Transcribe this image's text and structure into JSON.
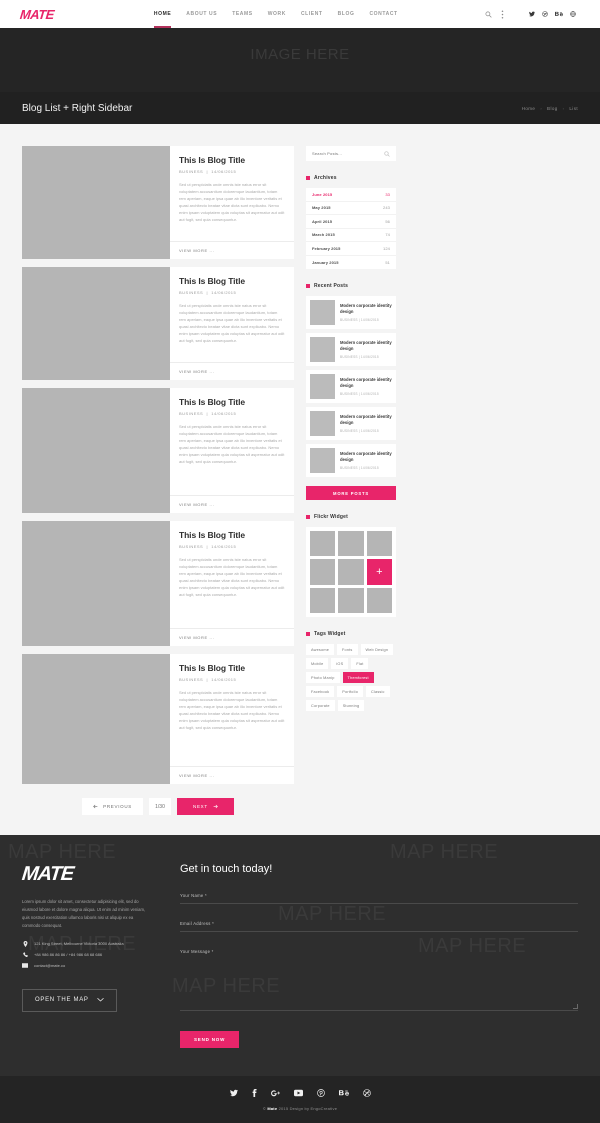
{
  "header": {
    "logo": "MATE",
    "nav": [
      {
        "label": "HOME",
        "active": true
      },
      {
        "label": "ABOUT US",
        "active": false
      },
      {
        "label": "TEAMS",
        "active": false
      },
      {
        "label": "WORK",
        "active": false
      },
      {
        "label": "CLIENT",
        "active": false
      },
      {
        "label": "BLOG",
        "active": false
      },
      {
        "label": "CONTACT",
        "active": false
      }
    ],
    "icons": [
      "search-icon",
      "more-vertical-icon"
    ],
    "social": [
      "twitter-icon",
      "dribbble-icon",
      "behance-icon",
      "globe-icon"
    ]
  },
  "hero": {
    "placeholder": "IMAGE HERE",
    "title": "Blog List + Right Sidebar",
    "breadcrumb": [
      "Home",
      "Blog",
      "List"
    ]
  },
  "posts": [
    {
      "title": "This Is Blog Title",
      "category": "BUSINESS",
      "date": "14/06/2015",
      "excerpt": "Sed ut perspiciatis unde omnis iste natus error sit voluptatem accusantium doloremque laudantium, totam rem aperiam, eaque ipsa quae ab illo inventore veritatis et quasi architecto beatae vitae dicta sunt explicabo. Nemo enim ipsam voluptatem quia voluptas sit aspernatur aut odit aut fugit, sed quia consequuntur.",
      "more_label": "VIEW MORE ..."
    },
    {
      "title": "This Is Blog Title",
      "category": "BUSINESS",
      "date": "14/06/2015",
      "excerpt": "Sed ut perspiciatis unde omnis iste natus error sit voluptatem accusantium doloremque laudantium, totam rem aperiam, eaque ipsa quae ab illo inventore veritatis et quasi architecto beatae vitae dicta sunt explicabo. Nemo enim ipsam voluptatem quia voluptas sit aspernatur aut odit aut fugit, sed quia consequuntur.",
      "more_label": "VIEW MORE ..."
    },
    {
      "title": "This Is Blog Title",
      "category": "BUSINESS",
      "date": "14/06/2015",
      "excerpt": "Sed ut perspiciatis unde omnis iste natus error sit voluptatem accusantium doloremque laudantium, totam rem aperiam, eaque ipsa quae ab illo inventore veritatis et quasi architecto beatae vitae dicta sunt explicabo. Nemo enim ipsam voluptatem quia voluptas sit aspernatur aut odit aut fugit, sed quia consequuntur.",
      "more_label": "VIEW MORE ..."
    },
    {
      "title": "This Is Blog Title",
      "category": "BUSINESS",
      "date": "14/06/2015",
      "excerpt": "Sed ut perspiciatis unde omnis iste natus error sit voluptatem accusantium doloremque laudantium, totam rem aperiam, eaque ipsa quae ab illo inventore veritatis et quasi architecto beatae vitae dicta sunt explicabo. Nemo enim ipsam voluptatem quia voluptas sit aspernatur aut odit aut fugit, sed quia consequuntur.",
      "more_label": "VIEW MORE ..."
    },
    {
      "title": "This Is Blog Title",
      "category": "BUSINESS",
      "date": "14/06/2015",
      "excerpt": "Sed ut perspiciatis unde omnis iste natus error sit voluptatem accusantium doloremque laudantium, totam rem aperiam, eaque ipsa quae ab illo inventore veritatis et quasi architecto beatae vitae dicta sunt explicabo. Nemo enim ipsam voluptatem quia voluptas sit aspernatur aut odit aut fugit, sed quia consequuntur.",
      "more_label": "VIEW MORE ..."
    }
  ],
  "pagination": {
    "previous": "PREVIOUS",
    "page": "1/30",
    "next": "NEXT"
  },
  "sidebar": {
    "search_placeholder": "Search Posts...",
    "archives": {
      "title": "Archives",
      "rows": [
        {
          "label": "June 2015",
          "count": "33",
          "active": true
        },
        {
          "label": "May 2015",
          "count": "243",
          "active": false
        },
        {
          "label": "April 2015",
          "count": "56",
          "active": false
        },
        {
          "label": "March 2015",
          "count": "74",
          "active": false
        },
        {
          "label": "February 2015",
          "count": "124",
          "active": false
        },
        {
          "label": "January 2015",
          "count": "51",
          "active": false
        }
      ]
    },
    "recent_posts": {
      "title": "Recent Posts",
      "items": [
        {
          "title": "Modern corporate identity design",
          "meta": "BUSINESS   |   14/06/2015"
        },
        {
          "title": "Modern corporate identity design",
          "meta": "BUSINESS   |   14/06/2015"
        },
        {
          "title": "Modern corporate identity design",
          "meta": "BUSINESS   |   14/06/2015"
        },
        {
          "title": "Modern corporate identity design",
          "meta": "BUSINESS   |   14/06/2015"
        },
        {
          "title": "Modern corporate identity design",
          "meta": "BUSINESS   |   14/06/2015"
        }
      ],
      "more_label": "MORE POSTS"
    },
    "flickr": {
      "title": "Flickr Widget",
      "tiles": 9,
      "active_index": 5,
      "active_glyph": "+"
    },
    "tags": {
      "title": "Tags Widget",
      "items": [
        {
          "label": "Awesome",
          "active": false
        },
        {
          "label": "Fonts",
          "active": false
        },
        {
          "label": "Web Design",
          "active": false
        },
        {
          "label": "Mobile",
          "active": false
        },
        {
          "label": "iOS",
          "active": false
        },
        {
          "label": "Flat",
          "active": false
        },
        {
          "label": "Photo Manip",
          "active": false
        },
        {
          "label": "Themforest",
          "active": true
        },
        {
          "label": "Facebook",
          "active": false
        },
        {
          "label": "Portfolio",
          "active": false
        },
        {
          "label": "Classic",
          "active": false
        },
        {
          "label": "Corporate",
          "active": false
        },
        {
          "label": "Stunning",
          "active": false
        }
      ]
    }
  },
  "footer": {
    "map_ghost": "MAP HERE",
    "logo": "MATE",
    "about": "Lorem ipsum dolor sit amet, consectetur adipisicing elit, sed do eiusmod labore et dolore magna aliqua. Ut enim ad minim veniam, quis nostrud exercitation ullamco laboris nisi ut aliquip ex ea commodo consequat.",
    "contacts": [
      {
        "icon": "location-pin-icon",
        "text": "121 King Street, Melbourne Victoria 3000 Australia"
      },
      {
        "icon": "phone-icon",
        "text": "+84 986 86 86 86 / +84 986 68 68 686"
      },
      {
        "icon": "envelope-icon",
        "text": "contact@mate.co"
      }
    ],
    "map_button": "OPEN THE MAP",
    "form": {
      "heading": "Get in touch today!",
      "name_label": "Your Name *",
      "email_label": "Email Address *",
      "message_label": "Your Message *",
      "submit": "SEND NOW"
    }
  },
  "bottom": {
    "social": [
      "twitter-icon",
      "facebook-icon",
      "google-plus-icon",
      "youtube-icon",
      "pinterest-icon",
      "behance-icon",
      "dribbble-icon"
    ],
    "copyright_prefix": "© ",
    "copyright_brand": "Mate",
    "copyright_suffix": " 2015 Design by EngoCreative"
  },
  "colors": {
    "accent": "#e8256a",
    "dark": "#2e2e2e",
    "hero": "#252525",
    "page_bg": "#f4f4f4"
  }
}
